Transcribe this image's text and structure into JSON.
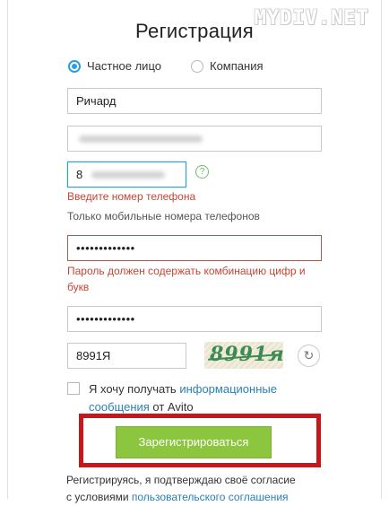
{
  "watermark": "MYDIV.NET",
  "title": "Регистрация",
  "account_type": {
    "options": [
      {
        "label": "Частное лицо",
        "checked": true
      },
      {
        "label": "Компания",
        "checked": false
      }
    ]
  },
  "fields": {
    "name_value": "Ричард",
    "phone_value": "8",
    "password_value": "•••••••••••••",
    "password_confirm_value": "•••••••••••••",
    "captcha_value": "8991Я"
  },
  "messages": {
    "phone_error": "Введите номер телефона",
    "phone_note": "Только мобильные номера телефонов",
    "password_error_line1": "Пароль должен содержать комбинацию цифр и",
    "password_error_line2": "букв"
  },
  "captcha": {
    "image_text": "8991я",
    "help_symbol": "?",
    "refresh_symbol": "↻"
  },
  "consent": {
    "prefix": "Я хочу получать ",
    "link": "информационные сообщения",
    "suffix": " от Avito",
    "checked": false
  },
  "submit_label": "Зарегистрироваться",
  "footer": {
    "line1": "Регистрируясь, я подтверждаю своё согласие",
    "line2_prefix": "с условиями ",
    "line2_link": "пользовательского соглашения"
  },
  "colors": {
    "accent": "#2a9de0",
    "error": "#c44536",
    "submit": "#8cc63f",
    "highlight": "#c4191c",
    "link": "#2a7fb6"
  }
}
